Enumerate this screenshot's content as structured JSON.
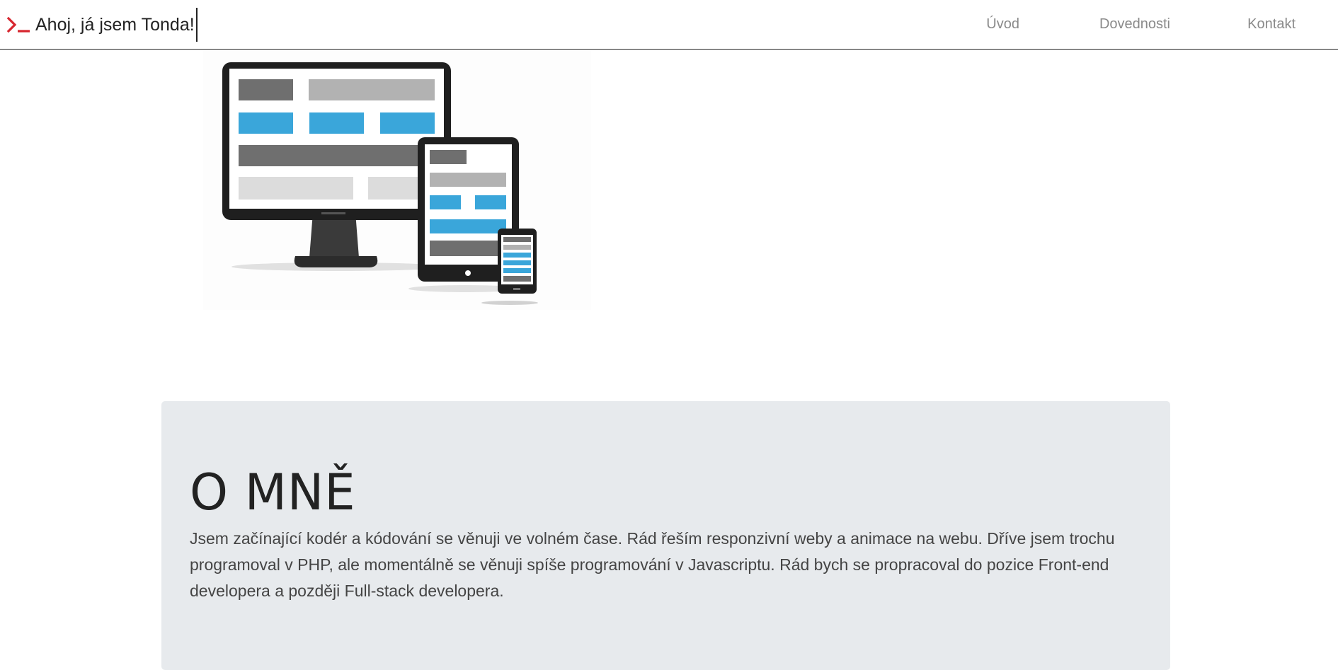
{
  "navbar": {
    "brand_text": "Ahoj, já jsem Tonda!",
    "brand_icon": "terminal-prompt-icon",
    "links": [
      {
        "label": "Úvod"
      },
      {
        "label": "Dovednosti"
      },
      {
        "label": "Kontakt"
      }
    ]
  },
  "hero": {
    "image_description_icon": "responsive-devices-illustration"
  },
  "about": {
    "heading": "O MNĚ",
    "text": "Jsem začínající kodér a kódování se věnuji ve volném čase. Rád řeším responzivní weby a animace na webu. Dříve jsem trochu programoval v PHP, ale momentálně se věnuji spíše programování v Javascriptu. Rád bych se propracoval do pozice Front-end developera a později Full-stack developera."
  },
  "colors": {
    "accent": "#d7262f",
    "nav_link": "#8a8a8a",
    "about_bg": "#e7eaed",
    "device_blue": "#3aa6da"
  }
}
